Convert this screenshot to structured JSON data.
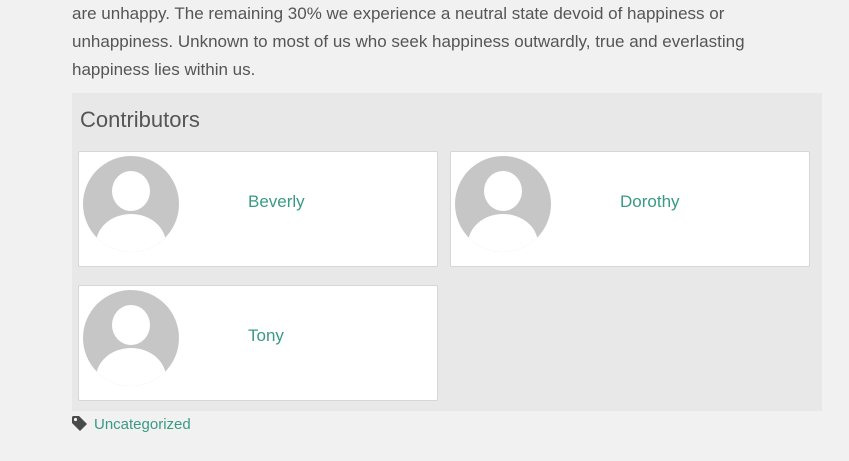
{
  "intro": {
    "lines": [
      "are unhappy. The remaining 30% we experience a neutral state devoid of happiness or",
      "unhappiness. Unknown to most of us who seek happiness outwardly, true and everlasting",
      "happiness lies within us."
    ]
  },
  "contributors": {
    "title": "Contributors",
    "items": [
      {
        "name": "Beverly",
        "avatar_icon": "default-user-avatar-icon"
      },
      {
        "name": "Dorothy",
        "avatar_icon": "default-user-avatar-icon"
      },
      {
        "name": "Tony",
        "avatar_icon": "default-user-avatar-icon"
      }
    ]
  },
  "tags": {
    "icon": "tag-icon",
    "category": "Uncategorized"
  },
  "colors": {
    "link": "#3a9a84",
    "text": "#555555",
    "box_bg": "#e8e8e8",
    "page_bg": "#f1f1f1",
    "avatar_gray": "#c6c6c6"
  }
}
